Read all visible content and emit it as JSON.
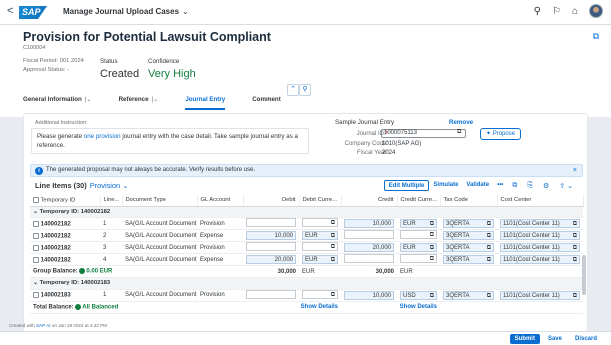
{
  "shell": {
    "back": "<",
    "logo": "SAP",
    "app_title": "Manage Journal Upload Cases",
    "title_caret": "⌄",
    "icons": [
      "search-icon",
      "notifications-icon",
      "help-icon",
      "user-avatar"
    ],
    "search_glyph": "⚲",
    "bell_glyph": "⚐",
    "help_glyph": "⌂"
  },
  "header": {
    "title": "Provision for Potential Lawsuit Compliant",
    "case_id": "C100004",
    "fiscal_period": "Fiscal Period: 001.2024",
    "approval_status": "Approval Status: -",
    "status_label": "Status",
    "status_value": "Created",
    "confidence_label": "Confidence",
    "confidence_value": "Very High",
    "edit_glyph": "⧉"
  },
  "tabs": [
    {
      "label": "General Information",
      "chev": "|⌄"
    },
    {
      "label": "Reference",
      "chev": "|⌄"
    },
    {
      "label": "Journal Entry",
      "chev": ""
    },
    {
      "label": "Comment",
      "chev": ""
    }
  ],
  "instruction": {
    "label": "Additional Instruction:",
    "text_a": "Please generate ",
    "text_b": "one provision",
    "text_c": " journal entry with the case detail. Take sample journal entry as a reference."
  },
  "sample": {
    "title": "Sample Journal Entry",
    "remove": "Remove",
    "journal_id_label": "Journal ID:",
    "journal_id_req": "*",
    "journal_id_value": "1000075113",
    "propose": "Propose",
    "company_code_label": "Company Code:",
    "company_code_value": "1010(SAP AG)",
    "fiscal_year_label": "Fiscal Year:",
    "fiscal_year_value": "2024"
  },
  "info_message": "The generated proposal may not always be accurate. Verify results before use.",
  "line_items": {
    "title": "Line Items (30)",
    "variant": "Provision",
    "variant_caret": "⌄",
    "toolbar": [
      "Edit Multiple",
      "Simulate",
      "Validate"
    ],
    "more": "•••",
    "columns": [
      "Temporary ID",
      "Line...",
      "Document Type",
      "GL Account",
      "Debit",
      "Debit Curre...",
      "Credit",
      "Credit Curre...",
      "Tax Code",
      "Cost Center"
    ],
    "group1": "Temporary ID: 140002182",
    "rows1": [
      {
        "id": "140002182",
        "line": "1",
        "doc": "SA(G/L Account Document)",
        "gl": "Provision",
        "debit": "",
        "dcur": "",
        "credit": "10,000",
        "ccur": "EUR",
        "tax": "3QERTA",
        "cc": "1101(Cost Center 11)"
      },
      {
        "id": "140002182",
        "line": "2",
        "doc": "SA(G/L Account Document)",
        "gl": "Expense",
        "debit": "10,000",
        "dcur": "EUR",
        "credit": "",
        "ccur": "",
        "tax": "3QERTA",
        "cc": "1101(Cost Center 11)"
      },
      {
        "id": "140002182",
        "line": "3",
        "doc": "SA(G/L Account Document)",
        "gl": "Provision",
        "debit": "",
        "dcur": "",
        "credit": "20,000",
        "ccur": "EUR",
        "tax": "3QERTA",
        "cc": "1101(Cost Center 11)"
      },
      {
        "id": "140002182",
        "line": "4",
        "doc": "SA(G/L Account Document)",
        "gl": "Expense",
        "debit": "20,000",
        "dcur": "EUR",
        "credit": "",
        "ccur": "",
        "tax": "3QERTA",
        "cc": "1101(Cost Center 11)"
      }
    ],
    "group_balance_label": "Group Balance:",
    "group_balance_value": "0.00 EUR",
    "group_debit_total": "30,000",
    "group_debit_cur": "EUR",
    "group_credit_total": "30,000",
    "group_credit_cur": "EUR",
    "group2": "Temporary ID: 140002183",
    "rows2": [
      {
        "id": "140002183",
        "line": "1",
        "doc": "SA(G/L Account Document)",
        "gl": "Provision",
        "debit": "",
        "dcur": "",
        "credit": "10,000",
        "ccur": "USD",
        "tax": "3QERTA",
        "cc": "1101(Cost Center 11)"
      }
    ],
    "total_balance_label": "Total Balance:",
    "total_balance_value": "All Balanced",
    "show_details": "Show Details"
  },
  "created_note_a": "Created with ",
  "created_note_link": "SAP AI",
  "created_note_b": " on Jan 19 2024 at 4:42 PM",
  "footer": {
    "submit": "Submit",
    "save": "Save",
    "discard": "Discard"
  }
}
